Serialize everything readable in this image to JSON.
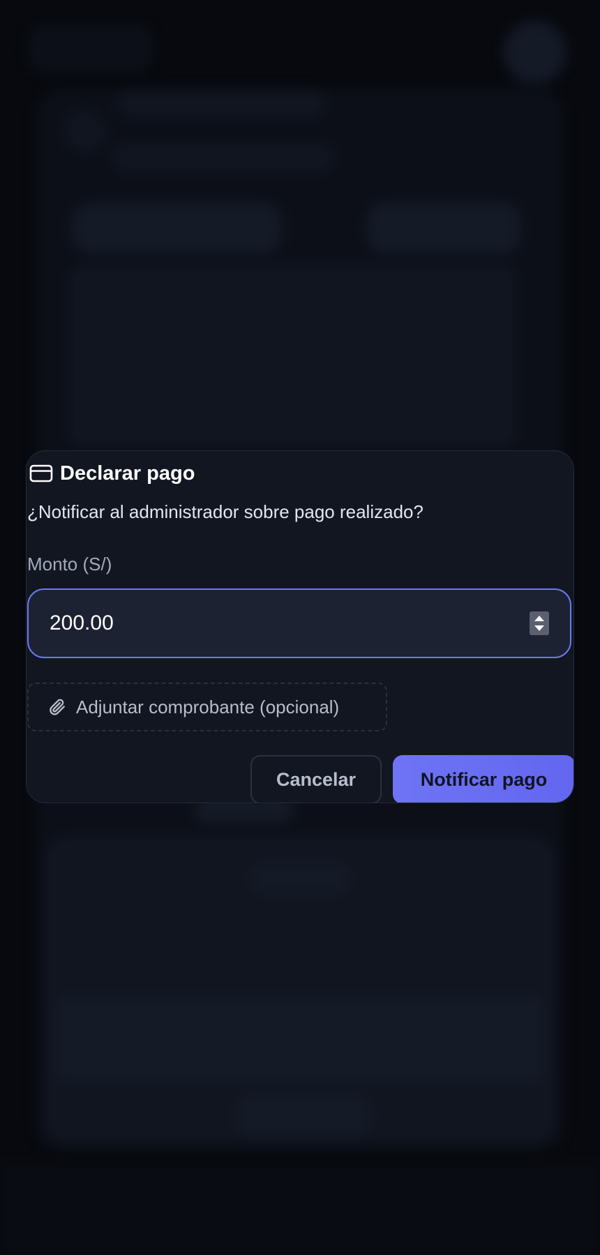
{
  "modal": {
    "title": "Declarar pago",
    "title_icon": "credit-card-icon",
    "question": "¿Notificar al administrador sobre pago realizado?",
    "amount_label": "Monto (S/)",
    "amount_value": "200.00",
    "attach_label": "Adjuntar comprobante (opcional)",
    "attach_icon": "paperclip-icon",
    "cancel_label": "Cancelar",
    "submit_label": "Notificar pago"
  },
  "colors": {
    "background": "#07090e",
    "modal_bg": "#121621",
    "accent": "#6d78f0",
    "primary_button": "#6e74f5",
    "input_bg": "#1d2233"
  }
}
